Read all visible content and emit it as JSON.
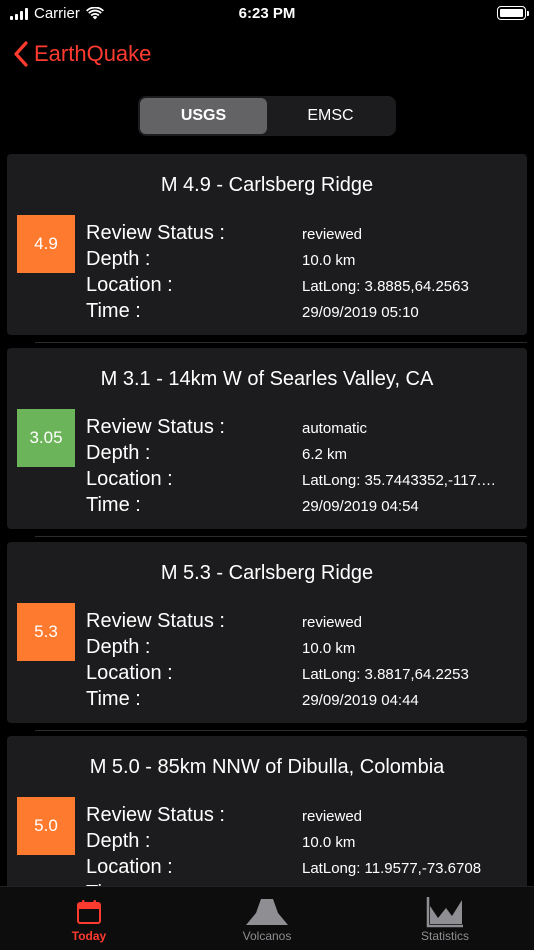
{
  "status": {
    "carrier": "Carrier",
    "time": "6:23 PM"
  },
  "nav": {
    "back_label": "EarthQuake"
  },
  "segments": [
    "USGS",
    "EMSC"
  ],
  "field_labels": {
    "review_status": "Review Status :",
    "depth": "Depth :",
    "location": "Location :",
    "time": "Time :"
  },
  "quakes": [
    {
      "title": "M 4.9 - Carlsberg Ridge",
      "magnitude": "4.9",
      "color": "#fe7a2f",
      "review_status": "reviewed",
      "depth": "10.0 km",
      "location": "LatLong: 3.8885,64.2563",
      "time": "29/09/2019 05:10"
    },
    {
      "title": "M 3.1 - 14km W of Searles Valley, CA",
      "magnitude": "3.05",
      "color": "#6cb45a",
      "review_status": "automatic",
      "depth": "6.2 km",
      "location": "LatLong: 35.7443352,-117.…",
      "time": "29/09/2019 04:54"
    },
    {
      "title": "M 5.3 - Carlsberg Ridge",
      "magnitude": "5.3",
      "color": "#fe7a2f",
      "review_status": "reviewed",
      "depth": "10.0 km",
      "location": "LatLong: 3.8817,64.2253",
      "time": "29/09/2019 04:44"
    },
    {
      "title": "M 5.0 - 85km NNW of Dibulla, Colombia",
      "magnitude": "5.0",
      "color": "#fe7a2f",
      "review_status": "reviewed",
      "depth": "10.0 km",
      "location": "LatLong: 11.9577,-73.6708",
      "time": ""
    }
  ],
  "tabs": [
    {
      "label": "Today",
      "icon": "calendar-icon"
    },
    {
      "label": "Volcanos",
      "icon": "volcano-icon"
    },
    {
      "label": "Statistics",
      "icon": "chart-icon"
    }
  ],
  "colors": {
    "accent": "#ff3b30",
    "orange": "#fe7a2f",
    "green": "#6cb45a"
  }
}
